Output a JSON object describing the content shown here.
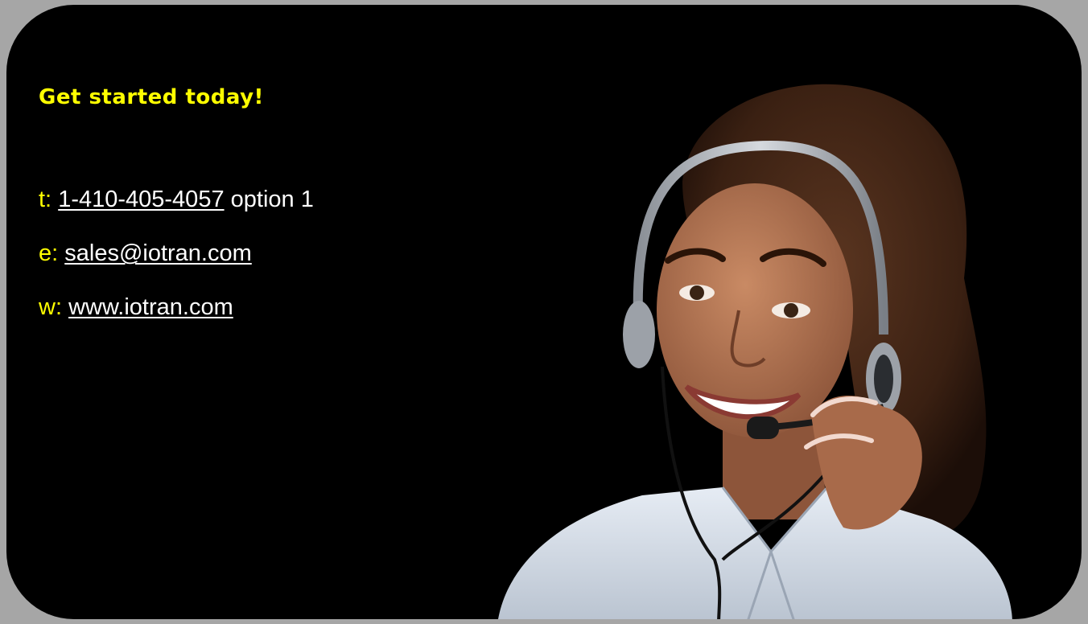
{
  "headline": "Get started today!",
  "contact": {
    "phone": {
      "prefix": "t:",
      "link": "1-410-405-4057",
      "suffix": "option 1"
    },
    "email": {
      "prefix": "e:",
      "link": "sales@iotran.com"
    },
    "web": {
      "prefix": "w:",
      "link": "www.iotran.com"
    }
  },
  "colors": {
    "background": "#a6a6a6",
    "card": "#000000",
    "accent": "#ffff00",
    "text": "#ffffff"
  },
  "photo": {
    "subject": "support-agent-with-headset"
  }
}
